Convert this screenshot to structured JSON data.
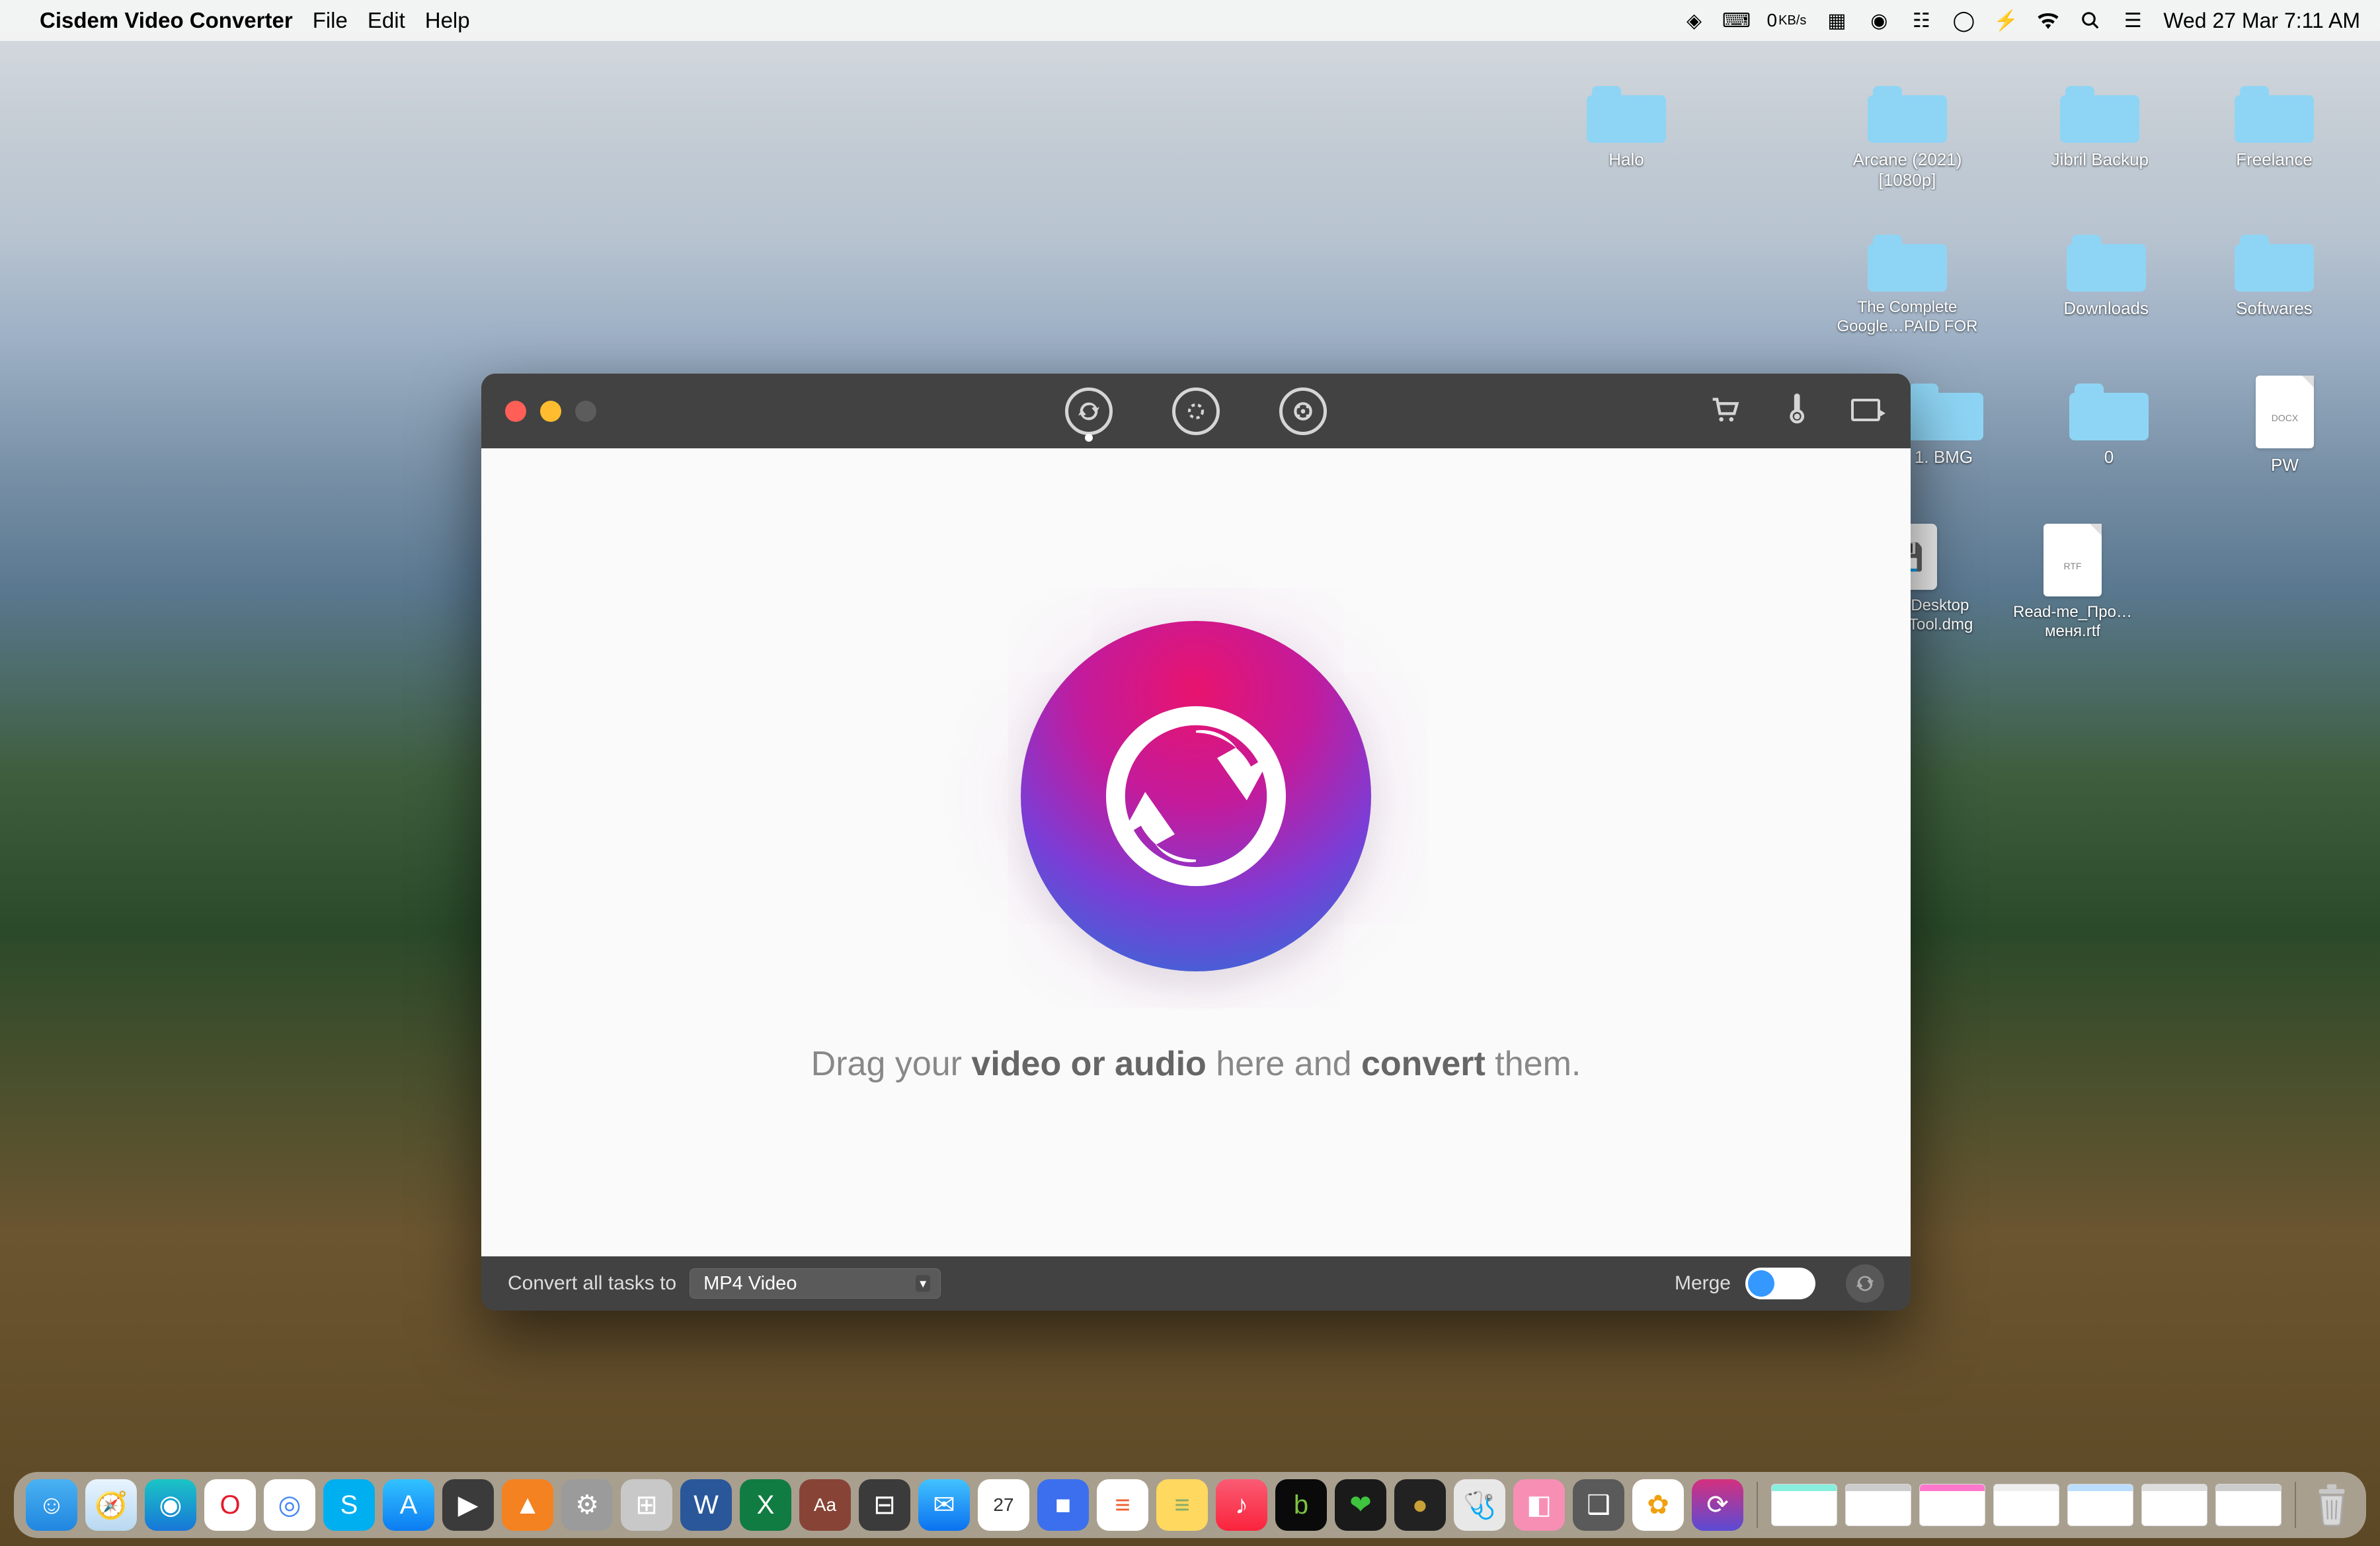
{
  "menubar": {
    "app_name": "Cisdem Video Converter",
    "items": [
      "File",
      "Edit",
      "Help"
    ],
    "network_speed": "0",
    "network_unit": "KB/s",
    "datetime": "Wed 27 Mar  7:11 AM"
  },
  "desktop": {
    "solo_halo": {
      "label": "Halo"
    },
    "grid": [
      {
        "type": "folder",
        "label": "Arcane (2021) [1080p]"
      },
      {
        "type": "folder",
        "label": "Jibril Backup"
      },
      {
        "type": "folder",
        "label": "Freelance"
      },
      {
        "type": "folder",
        "label": "The Complete Google…PAID FOR"
      },
      {
        "type": "folder",
        "label": "Downloads"
      },
      {
        "type": "folder",
        "label": "Softwares"
      },
      {
        "type": "folder",
        "label": "1. BMG"
      },
      {
        "type": "folder",
        "label": "0"
      },
      {
        "type": "docx",
        "label": "PW",
        "badge": "DOCX"
      },
      {
        "type": "dmg",
        "label": "Parallels Desktop Activati…Tool.dmg"
      },
      {
        "type": "rtf",
        "label": "Read-me_Про…меня.rtf",
        "badge": "RTF"
      }
    ]
  },
  "app": {
    "drop_text_1": "Drag your ",
    "drop_text_2": "video or audio",
    "drop_text_3": " here and ",
    "drop_text_4": "convert",
    "drop_text_5": " them.",
    "footer": {
      "convert_label": "Convert all tasks to",
      "format_selected": "MP4 Video",
      "merge_label": "Merge"
    }
  },
  "dock": {
    "apps": [
      {
        "name": "finder",
        "bg": "linear-gradient(#4ab2f2,#2086e0)",
        "glyph": "☺"
      },
      {
        "name": "safari",
        "bg": "linear-gradient(#e8f4ff,#b8d8f0)",
        "glyph": "🧭"
      },
      {
        "name": "edge",
        "bg": "linear-gradient(#1ac5c5,#1876d8)",
        "glyph": "◉"
      },
      {
        "name": "opera",
        "bg": "#fff",
        "glyph": "O",
        "fg": "#e41b2d"
      },
      {
        "name": "chrome",
        "bg": "#fff",
        "glyph": "◎",
        "fg": "#4285f4"
      },
      {
        "name": "skype",
        "bg": "#00aff0",
        "glyph": "S"
      },
      {
        "name": "appstore",
        "bg": "linear-gradient(#32c2ff,#0c7cf2)",
        "glyph": "A"
      },
      {
        "name": "quicktime",
        "bg": "#3b3b3b",
        "glyph": "▶"
      },
      {
        "name": "vlc",
        "bg": "#f58220",
        "glyph": "▲"
      },
      {
        "name": "settings",
        "bg": "#9b9b9b",
        "glyph": "⚙"
      },
      {
        "name": "launchpad",
        "bg": "#c8c8c8",
        "glyph": "⊞"
      },
      {
        "name": "word",
        "bg": "#2a579a",
        "glyph": "W"
      },
      {
        "name": "excel",
        "bg": "#107c41",
        "glyph": "X"
      },
      {
        "name": "dictionary",
        "bg": "#874436",
        "glyph": "Aa"
      },
      {
        "name": "calculator",
        "bg": "#3b3b3b",
        "glyph": "⊟"
      },
      {
        "name": "mail",
        "bg": "linear-gradient(#43c2ff,#0a72f0)",
        "glyph": "✉"
      },
      {
        "name": "calendar",
        "bg": "#fff",
        "glyph": "27",
        "fg": "#333"
      },
      {
        "name": "app-blue",
        "bg": "#3b6fed",
        "glyph": "■"
      },
      {
        "name": "reminders",
        "bg": "#fff",
        "glyph": "≡",
        "fg": "#f06030"
      },
      {
        "name": "notes",
        "bg": "#ffd860",
        "glyph": "≡",
        "fg": "#8a6"
      },
      {
        "name": "music",
        "bg": "linear-gradient(#fb5b74,#fa243c)",
        "glyph": "♪"
      },
      {
        "name": "app-green",
        "bg": "#0a0a0a",
        "glyph": "b",
        "fg": "#7dc242"
      },
      {
        "name": "health",
        "bg": "#1a1a1a",
        "glyph": "❤",
        "fg": "#3ec43e"
      },
      {
        "name": "app-gold",
        "bg": "#222",
        "glyph": "●",
        "fg": "#caa136"
      },
      {
        "name": "utility",
        "bg": "#e8e8e8",
        "glyph": "🩺",
        "fg": "#666"
      },
      {
        "name": "app-pink",
        "bg": "#f78fb4",
        "glyph": "◧"
      },
      {
        "name": "parallels",
        "bg": "#5a5a5a",
        "glyph": "❑"
      },
      {
        "name": "photos",
        "bg": "#fff",
        "glyph": "✿",
        "fg": "#f0a010"
      },
      {
        "name": "cisdem",
        "bg": "linear-gradient(#d4307e,#5b4bd4)",
        "glyph": "⟳"
      }
    ],
    "recent_count": 7
  }
}
